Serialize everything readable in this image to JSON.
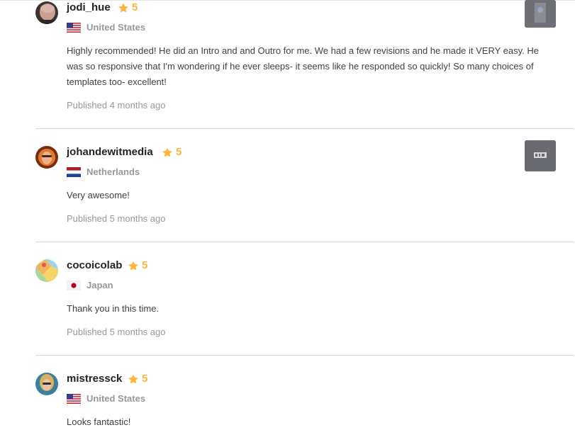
{
  "reviews": [
    {
      "username": "jodi_hue",
      "rating": "5",
      "country": "United States",
      "flag": "us-flag",
      "text": "Highly recommended! He did an Intro and and Outro for me. We had a few revisions and he made it VERY easy. He was so responsive that I'm wondering if he ever sleeps- it seems like he responded so quickly! So many choices of templates too- excellent!",
      "published": "Published 4 months ago"
    },
    {
      "username": "johandewitmedia",
      "rating": "5",
      "country": "Netherlands",
      "flag": "nl-flag",
      "text": "Very awesome!",
      "published": "Published 5 months ago"
    },
    {
      "username": "cocoicolab",
      "rating": "5",
      "country": "Japan",
      "flag": "jp-flag",
      "text": "Thank you in this time.",
      "published": "Published 5 months ago"
    },
    {
      "username": "mistressck",
      "rating": "5",
      "country": "United States",
      "flag": "us-flag",
      "text": "Looks fantastic!",
      "published": ""
    }
  ],
  "colors": {
    "star": "#ffb33e",
    "muted": "#95979d",
    "text": "#404145",
    "divider": "#dadbdd"
  }
}
